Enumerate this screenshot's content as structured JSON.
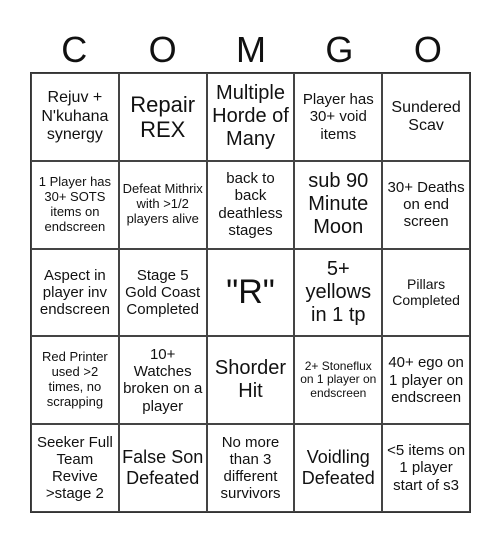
{
  "header": [
    "C",
    "O",
    "M",
    "G",
    "O"
  ],
  "cells": [
    "Rejuv + N'kuhana synergy",
    "Repair REX",
    "Multiple Horde of Many",
    "Player has 30+ void items",
    "Sundered Scav",
    "1 Player has 30+ SOTS items on endscreen",
    "Defeat Mithrix with >1/2 players alive",
    "back to back deathless stages",
    "sub 90 Minute Moon",
    "30+ Deaths on end screen",
    "Aspect in player inv endscreen",
    "Stage 5 Gold Coast Completed",
    "\"R\"",
    "5+ yellows in 1 tp",
    "Pillars Completed",
    "Red Printer used >2 times, no scrapping",
    "10+ Watches broken on a player",
    "Shorder Hit",
    "2+ Stoneflux on 1 player on endscreen",
    "40+ ego on 1 player on endscreen",
    "Seeker Full Team Revive >stage 2",
    "False Son Defeated",
    "No more than 3 different survivors",
    "Voidling Defeated",
    "<5 items on 1 player start of s3"
  ]
}
